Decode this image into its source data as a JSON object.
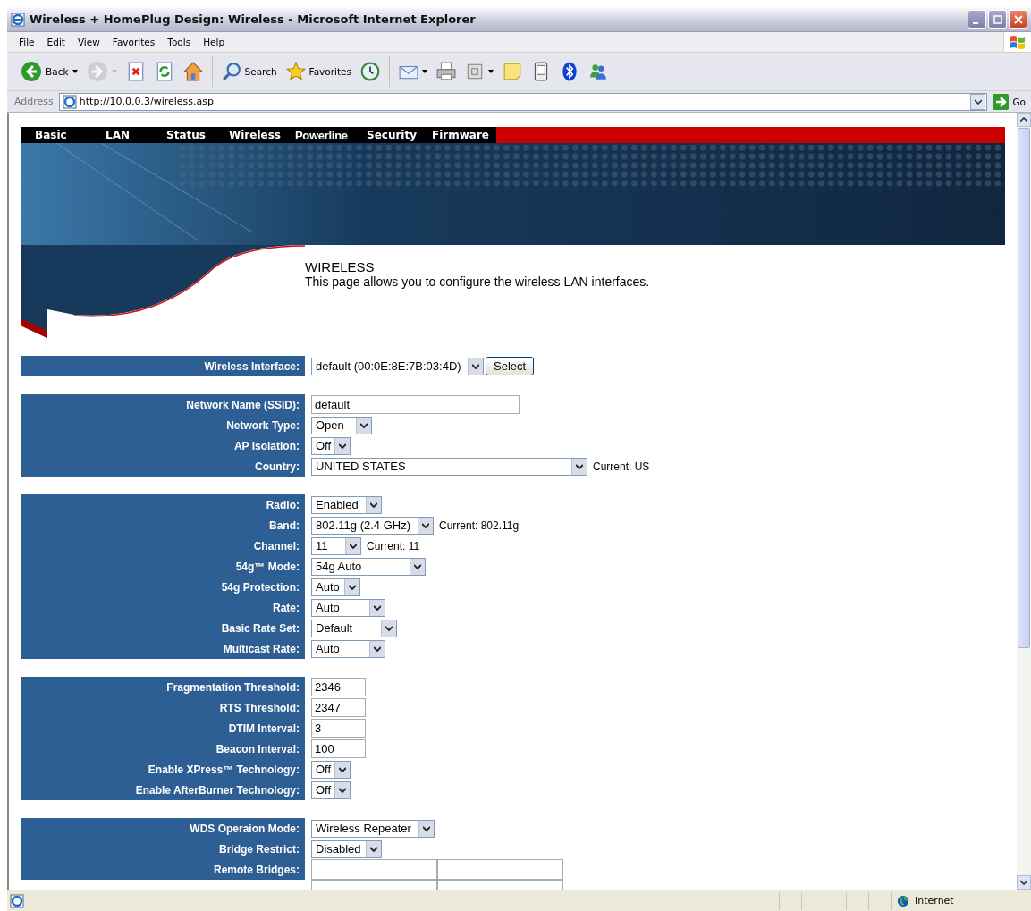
{
  "window": {
    "title": "Wireless + HomePlug Design: Wireless - Microsoft Internet Explorer"
  },
  "menu": [
    "File",
    "Edit",
    "View",
    "Favorites",
    "Tools",
    "Help"
  ],
  "toolbar": [
    {
      "kind": "back",
      "label": "Back",
      "dropdown": true,
      "disabled": false
    },
    {
      "kind": "forward",
      "dropdown": true,
      "disabled": true
    },
    {
      "kind": "stop",
      "dropdown": false,
      "disabled": false
    },
    {
      "kind": "refresh",
      "dropdown": false,
      "disabled": false
    },
    {
      "kind": "home",
      "dropdown": false,
      "disabled": false
    },
    {
      "kind": "separator"
    },
    {
      "kind": "search",
      "label": "Search",
      "dropdown": false,
      "disabled": false
    },
    {
      "kind": "favorites",
      "label": "Favorites",
      "dropdown": false,
      "disabled": false
    },
    {
      "kind": "history",
      "dropdown": false,
      "disabled": false
    },
    {
      "kind": "separator"
    },
    {
      "kind": "mail",
      "dropdown": true,
      "disabled": false
    },
    {
      "kind": "print",
      "dropdown": false,
      "disabled": false
    },
    {
      "kind": "edit",
      "dropdown": true,
      "disabled": false
    },
    {
      "kind": "note",
      "dropdown": false,
      "disabled": false
    },
    {
      "kind": "device",
      "dropdown": false,
      "disabled": false
    },
    {
      "kind": "bluetooth",
      "dropdown": false,
      "disabled": false
    },
    {
      "kind": "messenger",
      "dropdown": false,
      "disabled": false
    }
  ],
  "address": {
    "label": "Address",
    "url": "http://10.0.0.3/wireless.asp",
    "go": "Go"
  },
  "nav": [
    {
      "label": "Basic",
      "kind": "text"
    },
    {
      "label": "LAN",
      "kind": "text"
    },
    {
      "label": "Status",
      "kind": "text"
    },
    {
      "label": "Wireless",
      "kind": "text"
    },
    {
      "label": "Powerline",
      "kind": "logo"
    },
    {
      "label": "Security",
      "kind": "text"
    },
    {
      "label": "Firmware",
      "kind": "text"
    }
  ],
  "page": {
    "heading": "WIRELESS",
    "description": "This page allows you to configure the wireless LAN interfaces."
  },
  "sections": [
    {
      "rows": [
        {
          "label": "Wireless Interface:",
          "kind": "select",
          "value": "default (00:0E:8E:7B:03:4D)",
          "button": "Select"
        }
      ]
    },
    {
      "rows": [
        {
          "label": "Network Name (SSID):",
          "kind": "text",
          "value": "default"
        },
        {
          "label": "Network Type:",
          "kind": "select",
          "value": "Open"
        },
        {
          "label": "AP Isolation:",
          "kind": "select",
          "value": "Off"
        },
        {
          "label": "Country:",
          "kind": "select",
          "value": "UNITED STATES",
          "note": "Current: US"
        }
      ]
    },
    {
      "rows": [
        {
          "label": "Radio:",
          "kind": "select",
          "value": "Enabled"
        },
        {
          "label": "Band:",
          "kind": "select",
          "value": "802.11g (2.4 GHz)",
          "note": "Current: 802.11g"
        },
        {
          "label": "Channel:",
          "kind": "select",
          "value": "11",
          "note": "Current: 11"
        },
        {
          "label": "54g™ Mode:",
          "kind": "select",
          "value": "54g Auto"
        },
        {
          "label": "54g Protection:",
          "kind": "select",
          "value": "Auto"
        },
        {
          "label": "Rate:",
          "kind": "select",
          "value": "Auto"
        },
        {
          "label": "Basic Rate Set:",
          "kind": "select",
          "value": "Default"
        },
        {
          "label": "Multicast Rate:",
          "kind": "select",
          "value": "Auto"
        }
      ]
    },
    {
      "rows": [
        {
          "label": "Fragmentation Threshold:",
          "kind": "text",
          "value": "2346"
        },
        {
          "label": "RTS Threshold:",
          "kind": "text",
          "value": "2347"
        },
        {
          "label": "DTIM Interval:",
          "kind": "text",
          "value": "3"
        },
        {
          "label": "Beacon Interval:",
          "kind": "text",
          "value": "100"
        },
        {
          "label": "Enable XPress™ Technology:",
          "kind": "select",
          "value": "Off"
        },
        {
          "label": "Enable AfterBurner Technology:",
          "kind": "select",
          "value": "Off"
        }
      ]
    },
    {
      "rows": [
        {
          "label": "WDS Operaion Mode:",
          "kind": "select",
          "value": "Wireless Repeater"
        },
        {
          "label": "Bridge Restrict:",
          "kind": "select",
          "value": "Disabled"
        },
        {
          "label": "Remote Bridges:",
          "kind": "grid"
        }
      ]
    }
  ],
  "status_bar": {
    "zone": "Internet"
  }
}
